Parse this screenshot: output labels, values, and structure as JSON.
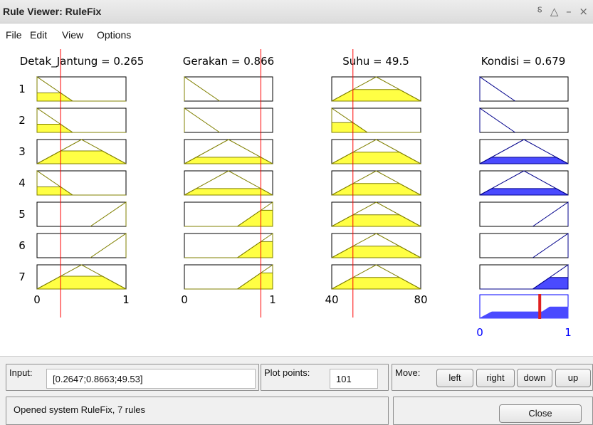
{
  "window": {
    "title": "Rule Viewer: RuleFix",
    "controls": "⸹ △ – ×"
  },
  "menu": [
    "File",
    "Edit",
    "View",
    "Options"
  ],
  "inputs": [
    {
      "name": "Detak_Jantung",
      "header": "Detak_Jantung = 0.265",
      "value": 0.2647,
      "range": [
        0,
        1
      ],
      "ticks": [
        "0",
        "1"
      ],
      "mf": [
        [
          0,
          0,
          0.4
        ],
        [
          0,
          0,
          0.4
        ],
        [
          0,
          0.5,
          1
        ],
        [
          0,
          0,
          0.4
        ],
        [
          0.6,
          1,
          1
        ],
        [
          0.6,
          1,
          1
        ],
        [
          0,
          0.5,
          1
        ]
      ]
    },
    {
      "name": "Gerakan",
      "header": "Gerakan = 0.866",
      "value": 0.8663,
      "range": [
        0,
        1
      ],
      "ticks": [
        "0",
        "1"
      ],
      "mf": [
        [
          0,
          0,
          0.4
        ],
        [
          0,
          0,
          0.4
        ],
        [
          0,
          0.5,
          1
        ],
        [
          0,
          0.5,
          1
        ],
        [
          0.6,
          1,
          1
        ],
        [
          0.6,
          1,
          1
        ],
        [
          0.6,
          1,
          1
        ]
      ]
    },
    {
      "name": "Suhu",
      "header": "Suhu = 49.5",
      "value": 49.53,
      "range": [
        40,
        80
      ],
      "ticks": [
        "40",
        "80"
      ],
      "mf": [
        [
          40,
          60,
          80
        ],
        [
          40,
          40,
          56
        ],
        [
          40,
          60,
          80
        ],
        [
          40,
          60,
          80
        ],
        [
          40,
          60,
          80
        ],
        [
          40,
          60,
          80
        ],
        [
          40,
          60,
          80
        ]
      ]
    }
  ],
  "output": {
    "name": "Kondisi",
    "header": "Kondisi = 0.679",
    "value": 0.679,
    "range": [
      0,
      1
    ],
    "ticks": [
      "0",
      "1"
    ],
    "mf": [
      [
        0,
        0,
        0.4
      ],
      [
        0,
        0,
        0.4
      ],
      [
        0,
        0.5,
        1
      ],
      [
        0,
        0.5,
        1
      ],
      [
        0.6,
        1,
        1
      ],
      [
        0.6,
        1,
        1
      ],
      [
        0.6,
        1,
        1
      ]
    ]
  },
  "rules": [
    "1",
    "2",
    "3",
    "4",
    "5",
    "6",
    "7"
  ],
  "colors": {
    "input_fill": "#ffff44",
    "output_fill": "#4a4aff",
    "mf_line_input": "#808000",
    "mf_line_output": "#00008b",
    "value_line": "#ff0000",
    "agg_line": "#e02020",
    "tick_out": "#0000ff"
  },
  "controls": {
    "input_label": "Input:",
    "input_value": "[0.2647;0.8663;49.53]",
    "plot_label": "Plot points:",
    "plot_value": "101",
    "move_label": "Move:",
    "buttons": {
      "left": "left",
      "right": "right",
      "down": "down",
      "up": "up"
    },
    "status": "Opened system RuleFix, 7 rules",
    "close": "Close"
  }
}
